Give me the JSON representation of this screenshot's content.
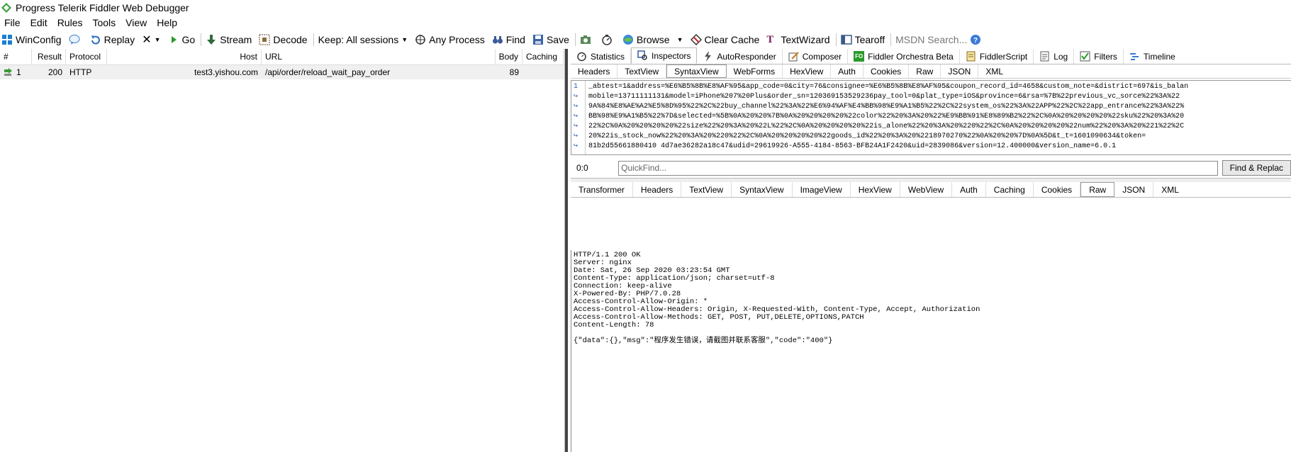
{
  "window": {
    "title": "Progress Telerik Fiddler Web Debugger"
  },
  "menu": [
    "File",
    "Edit",
    "Rules",
    "Tools",
    "View",
    "Help"
  ],
  "toolbar": {
    "winconfig": "WinConfig",
    "replay": "Replay",
    "go": "Go",
    "stream": "Stream",
    "decode": "Decode",
    "keep": "Keep: All sessions",
    "any_process": "Any Process",
    "find": "Find",
    "save": "Save",
    "browse": "Browse",
    "clear_cache": "Clear Cache",
    "textwizard": "TextWizard",
    "tearoff": "Tearoff",
    "msdn_search": "MSDN Search..."
  },
  "sessions": {
    "columns": {
      "num": "#",
      "result": "Result",
      "protocol": "Protocol",
      "host": "Host",
      "url": "URL",
      "body": "Body",
      "caching": "Caching"
    },
    "rows": [
      {
        "num": "1",
        "result": "200",
        "protocol": "HTTP",
        "host": "test3.yishou.com",
        "url": "/api/order/reload_wait_pay_order",
        "body": "89",
        "caching": ""
      }
    ]
  },
  "main_tabs": [
    "Statistics",
    "Inspectors",
    "AutoResponder",
    "Composer",
    "Fiddler Orchestra Beta",
    "FiddlerScript",
    "Log",
    "Filters",
    "Timeline"
  ],
  "request_tabs": [
    "Headers",
    "TextView",
    "SyntaxView",
    "WebForms",
    "HexView",
    "Auth",
    "Cookies",
    "Raw",
    "JSON",
    "XML"
  ],
  "request_lines": [
    "_abtest=1&address=%E6%B5%8B%E8%AF%95&app_code=0&city=76&consignee=%E6%B5%8B%E8%AF%95&coupon_record_id=4658&custom_note=&district=697&is_balan",
    "mobile=13711111131&model=iPhone%207%20Plus&order_sn=120369153529236pay_tool=0&plat_type=iOS&province=6&rsa=%7B%22previous_vc_sorce%22%3A%22",
    "9A%84%E8%AE%A2%E5%8D%95%22%2C%22buy_channel%22%3A%22%E6%94%AF%E4%BB%98%E9%A1%B5%22%2C%22system_os%22%3A%22APP%22%2C%22app_entrance%22%3A%22%",
    "BB%98%E9%A1%B5%22%7D&selected=%5B%0A%20%20%7B%0A%20%20%20%20%22color%22%20%3A%20%22%E9%BB%91%E8%89%B2%22%2C%0A%20%20%20%20%22sku%22%20%3A%20",
    "22%2C%0A%20%20%20%20%22size%22%20%3A%20%22L%22%2C%0A%20%20%20%20%22is_alone%22%20%3A%20%220%22%2C%0A%20%20%20%20%22num%22%20%3A%20%221%22%2C",
    "20%22is_stock_now%22%20%3A%20%220%22%2C%0A%20%20%20%20%22goods_id%22%20%3A%20%2218970270%22%0A%20%20%7D%0A%5D&t_t=1601090634&token=",
    "81b2d55661880410 4d7ae36282a18c47&udid=29619926-A555-4184-8563-BFB24A1F2420&uid=2839086&version=12.400000&version_name=6.0.1"
  ],
  "quickfind": {
    "position": "0:0",
    "placeholder": "QuickFind...",
    "button": "Find & Replac"
  },
  "response_tabs": [
    "Transformer",
    "Headers",
    "TextView",
    "SyntaxView",
    "ImageView",
    "HexView",
    "WebView",
    "Auth",
    "Caching",
    "Cookies",
    "Raw",
    "JSON",
    "XML"
  ],
  "response_lines": [
    "HTTP/1.1 200 OK",
    "Server: nginx",
    "Date: Sat, 26 Sep 2020 03:23:54 GMT",
    "Content-Type: application/json; charset=utf-8",
    "Connection: keep-alive",
    "X-Powered-By: PHP/7.0.28",
    "Access-Control-Allow-Origin: *",
    "Access-Control-Allow-Headers: Origin, X-Requested-With, Content-Type, Accept, Authorization",
    "Access-Control-Allow-Methods: GET, POST, PUT,DELETE,OPTIONS,PATCH",
    "Content-Length: 78"
  ],
  "response_body": "{\"data\":{},\"msg\":\"程序发生错误，请截图并联系客服\",\"code\":\"400\"}"
}
